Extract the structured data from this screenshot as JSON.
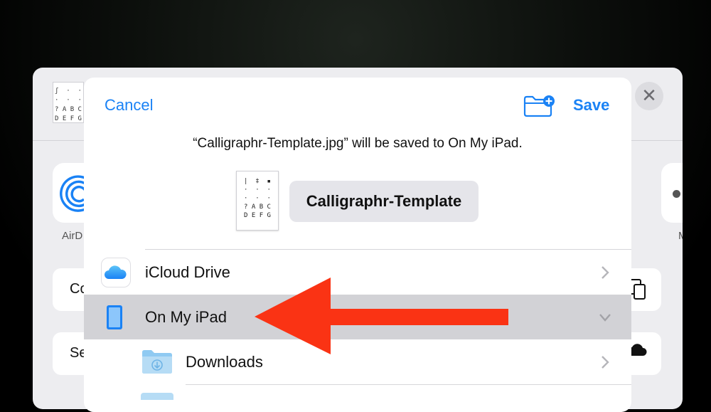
{
  "share_sheet": {
    "thumbnail_text": "ʃ  ·  ·\n·  ·  ·\n? A B C\nD E F G",
    "close_label": "✕",
    "airdrop_label": "AirD",
    "right_app_label": "M",
    "row1_label": "Co",
    "row2_label": "Se",
    "copy_icon": "copy-icon",
    "cloud_icon": "cloud-icon"
  },
  "dialog": {
    "cancel_label": "Cancel",
    "save_label": "Save",
    "new_folder_icon": "folder-plus-icon",
    "message": "“Calligraphr-Template.jpg” will be saved to On My iPad.",
    "thumbnail_text": "|  ‡  ▪\n·  ·  ·\n·  ·  ·\n? A B C\nD E F G",
    "filename": "Calligraphr-Template"
  },
  "locations": [
    {
      "label": "iCloud Drive",
      "icon": "icloud-icon",
      "chevron": "chevron-right-icon",
      "selected": false
    },
    {
      "label": "On My iPad",
      "icon": "ipad-icon",
      "chevron": "chevron-down-icon",
      "selected": true
    },
    {
      "label": "Downloads",
      "icon": "downloads-folder-icon",
      "chevron": "chevron-right-icon",
      "selected": false
    }
  ],
  "colors": {
    "accent": "#1a82f5",
    "annotation_arrow": "#fa3314",
    "selected_row": "#d2d2d6"
  }
}
